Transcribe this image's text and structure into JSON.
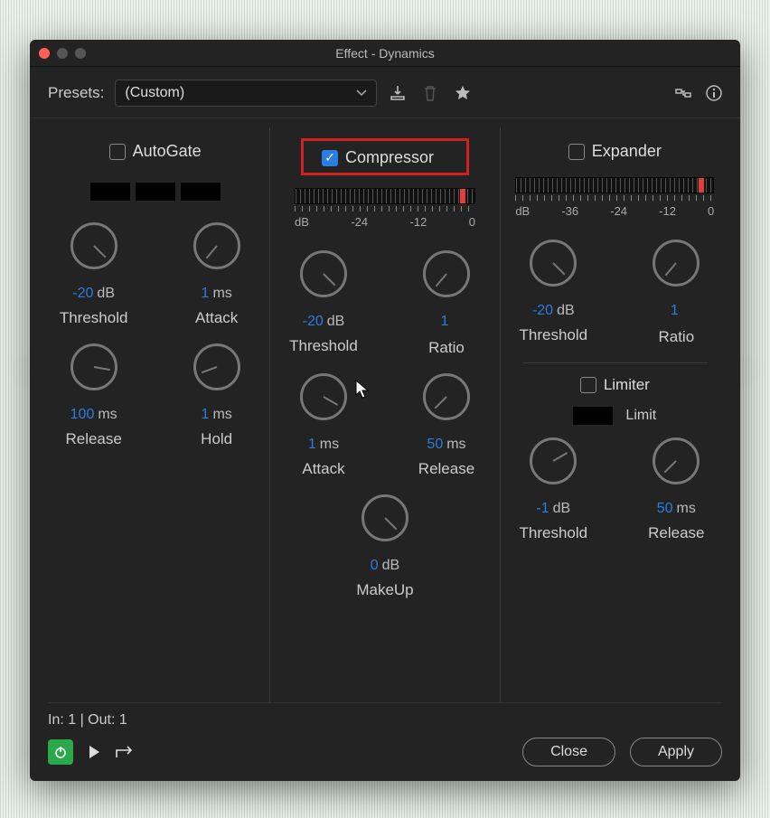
{
  "window": {
    "title": "Effect - Dynamics"
  },
  "presets": {
    "label": "Presets:",
    "value": "(Custom)"
  },
  "sections": {
    "autogate": {
      "title": "AutoGate",
      "checked": false,
      "knobs": {
        "threshold": {
          "value": "-20",
          "unit": "dB",
          "label": "Threshold"
        },
        "attack": {
          "value": "1",
          "unit": "ms",
          "label": "Attack"
        },
        "release": {
          "value": "100",
          "unit": "ms",
          "label": "Release"
        },
        "hold": {
          "value": "1",
          "unit": "ms",
          "label": "Hold"
        }
      }
    },
    "compressor": {
      "title": "Compressor",
      "checked": true,
      "meter": {
        "labels": [
          "dB",
          "-24",
          "-12",
          "0"
        ]
      },
      "knobs": {
        "threshold": {
          "value": "-20",
          "unit": "dB",
          "label": "Threshold"
        },
        "ratio": {
          "value": "1",
          "unit": "",
          "label": "Ratio"
        },
        "attack": {
          "value": "1",
          "unit": "ms",
          "label": "Attack"
        },
        "release": {
          "value": "50",
          "unit": "ms",
          "label": "Release"
        },
        "makeup": {
          "value": "0",
          "unit": "dB",
          "label": "MakeUp"
        }
      }
    },
    "expander": {
      "title": "Expander",
      "checked": false,
      "meter": {
        "labels": [
          "dB",
          "-36",
          "-24",
          "-12",
          "0"
        ]
      },
      "knobs": {
        "threshold": {
          "value": "-20",
          "unit": "dB",
          "label": "Threshold"
        },
        "ratio": {
          "value": "1",
          "unit": "",
          "label": "Ratio"
        }
      }
    },
    "limiter": {
      "title": "Limiter",
      "checked": false,
      "limit_label": "Limit",
      "knobs": {
        "threshold": {
          "value": "-1",
          "unit": "dB",
          "label": "Threshold"
        },
        "release": {
          "value": "50",
          "unit": "ms",
          "label": "Release"
        }
      }
    }
  },
  "footer": {
    "io": "In: 1 | Out: 1",
    "close": "Close",
    "apply": "Apply"
  }
}
